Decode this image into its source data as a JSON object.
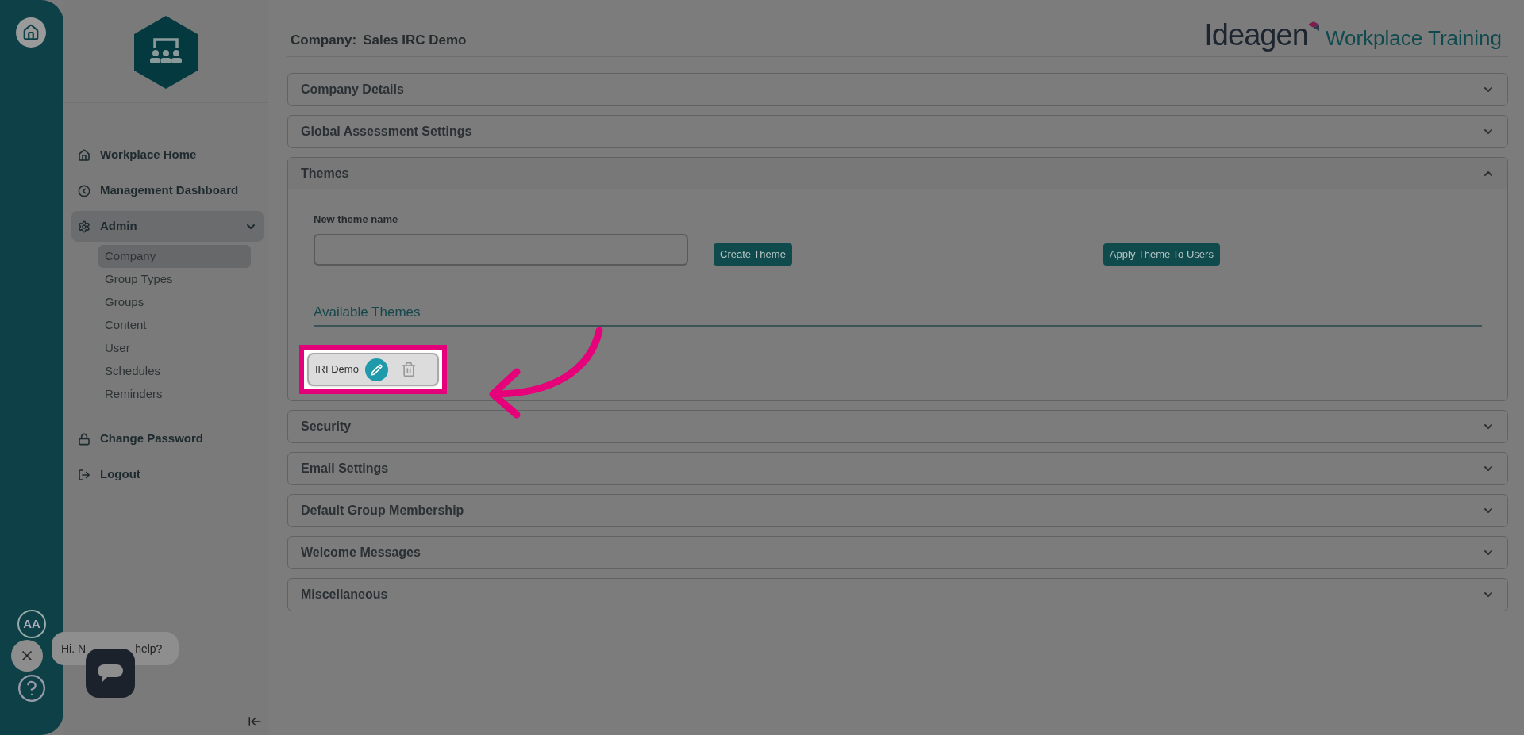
{
  "header": {
    "company_label": "Company:",
    "company_name": "Sales IRC Demo",
    "brand": "Ideagen",
    "product": "Workplace Training"
  },
  "rail": {
    "accessibility": "AA"
  },
  "sidebar": {
    "items": [
      {
        "label": "Workplace Home",
        "kind": "home",
        "selected": false
      },
      {
        "label": "Management Dashboard",
        "kind": "dashboard",
        "selected": false
      },
      {
        "label": "Admin",
        "kind": "admin",
        "selected": true,
        "expanded": true,
        "children": [
          {
            "label": "Company",
            "selected": true
          },
          {
            "label": "Group Types",
            "selected": false
          },
          {
            "label": "Groups",
            "selected": false
          },
          {
            "label": "Content",
            "selected": false
          },
          {
            "label": "User",
            "selected": false
          },
          {
            "label": "Schedules",
            "selected": false
          },
          {
            "label": "Reminders",
            "selected": false
          }
        ]
      },
      {
        "label": "Change Password",
        "kind": "password",
        "selected": false
      },
      {
        "label": "Logout",
        "kind": "logout",
        "selected": false
      }
    ]
  },
  "chat": {
    "greeting_start": "Hi. N",
    "greeting_end": "help?"
  },
  "sections": [
    {
      "title": "Company Details",
      "expanded": false
    },
    {
      "title": "Global Assessment Settings",
      "expanded": false
    },
    {
      "title": "Themes",
      "expanded": true,
      "field_label": "New theme name",
      "create_button": "Create Theme",
      "apply_button": "Apply Theme To Users",
      "list_title": "Available Themes",
      "themes": [
        {
          "name": "IRI Demo"
        }
      ]
    },
    {
      "title": "Security",
      "expanded": false
    },
    {
      "title": "Email Settings",
      "expanded": false
    },
    {
      "title": "Default Group Membership",
      "expanded": false
    },
    {
      "title": "Welcome Messages",
      "expanded": false
    },
    {
      "title": "Miscellaneous",
      "expanded": false
    }
  ]
}
